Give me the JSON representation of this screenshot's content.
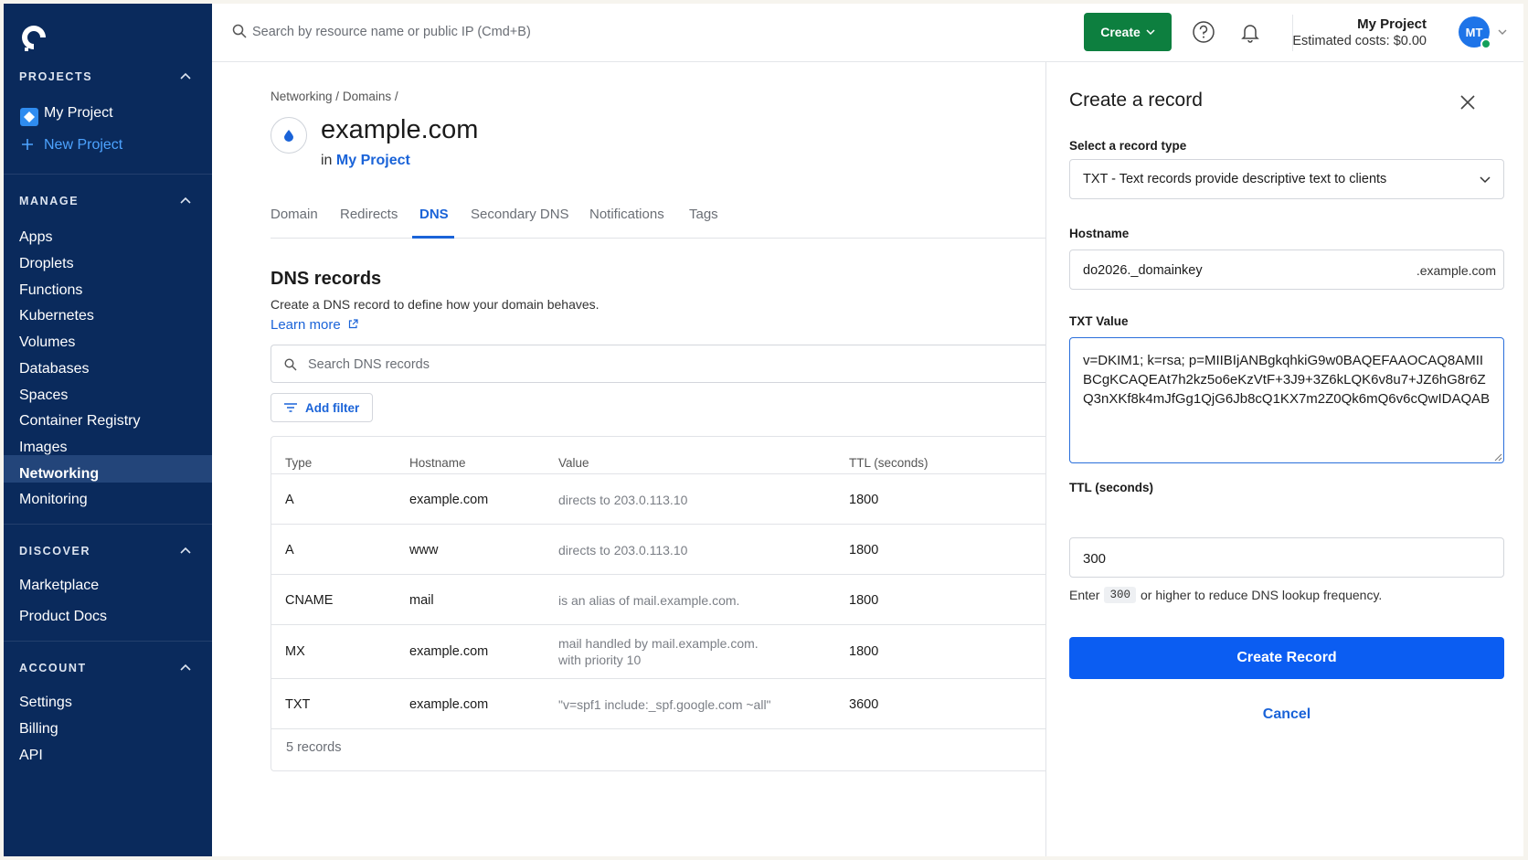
{
  "sidebar": {
    "logo": "digitalocean-logo",
    "projects_title": "PROJECTS",
    "project_item": "My Project",
    "new_project": "New Project",
    "manage_title": "MANAGE",
    "manage_items": [
      "Apps",
      "Droplets",
      "Functions",
      "Kubernetes",
      "Volumes",
      "Databases",
      "Spaces",
      "Container Registry",
      "Images",
      "Networking",
      "Monitoring"
    ],
    "active_item": "Networking",
    "discover_title": "DISCOVER",
    "discover_items": [
      "Marketplace",
      "Product Docs"
    ],
    "account_title": "ACCOUNT",
    "account_items": [
      "Settings",
      "Billing",
      "API"
    ]
  },
  "topbar": {
    "search_placeholder": "Search by resource name or public IP (Cmd+B)",
    "create_label": "Create",
    "project_name": "My Project",
    "estimated_costs": "Estimated costs: $0.00",
    "avatar_initials": "MT"
  },
  "main": {
    "breadcrumb": [
      "Networking",
      "/",
      "Domains",
      "/"
    ],
    "domain": "example.com",
    "in_label": "in",
    "project_link": "My Project",
    "tabs": [
      "Domain",
      "Redirects",
      "DNS",
      "Secondary DNS",
      "Notifications",
      "Tags"
    ],
    "active_tab": "DNS",
    "dns_title": "DNS records",
    "dns_desc": "Create a DNS record to define how your domain behaves.",
    "learn_more": "Learn more",
    "dns_search_placeholder": "Search DNS records",
    "add_filter": "Add filter",
    "table": {
      "headers": [
        "Type",
        "Hostname",
        "Value",
        "TTL (seconds)"
      ],
      "rows": [
        {
          "type": "A",
          "hostname": "example.com",
          "value": "directs to 203.0.113.10",
          "ttl": "1800"
        },
        {
          "type": "A",
          "hostname": "www",
          "value": "directs to 203.0.113.10",
          "ttl": "1800"
        },
        {
          "type": "CNAME",
          "hostname": "mail",
          "value": "is an alias of mail.example.com.",
          "ttl": "1800"
        },
        {
          "type": "MX",
          "hostname": "example.com",
          "value": "mail handled by mail.example.com.",
          "value2": "with priority 10",
          "ttl": "1800"
        },
        {
          "type": "TXT",
          "hostname": "example.com",
          "value": "\"v=spf1 include:_spf.google.com ~all\"",
          "ttl": "3600"
        }
      ],
      "footer": "5 records"
    }
  },
  "panel": {
    "title": "Create a record",
    "record_type_label": "Select a record type",
    "record_type_value": "TXT - Text records provide descriptive text to clients",
    "hostname_label": "Hostname",
    "hostname_value": "do2026._domainkey",
    "hostname_suffix": ".example.com",
    "txt_label": "TXT Value",
    "txt_value": "v=DKIM1; k=rsa; p=MIIBIjANBgkqhkiG9w0BAQEFAAOCAQ8AMIIBCgKCAQEAt7h2kz5o6eKzVtF+3J9+3Z6kLQK6v8u7+JZ6hG8r6ZQ3nXKf8k4mJfGg1QjG6Jb8cQ1KX7m2Z0Qk6mQ6v6cQwIDAQAB",
    "ttl_label": "TTL (seconds)",
    "ttl_value": "300",
    "hint_pre": "Enter",
    "hint_code": "300",
    "hint_post": "or higher to reduce DNS lookup frequency.",
    "create_button": "Create Record",
    "cancel_button": "Cancel"
  },
  "colors": {
    "sidebar_bg": "#0a2a5c",
    "create_green": "#0d7f3f",
    "primary_blue": "#0b5df2",
    "link_blue": "#1a63d8"
  }
}
